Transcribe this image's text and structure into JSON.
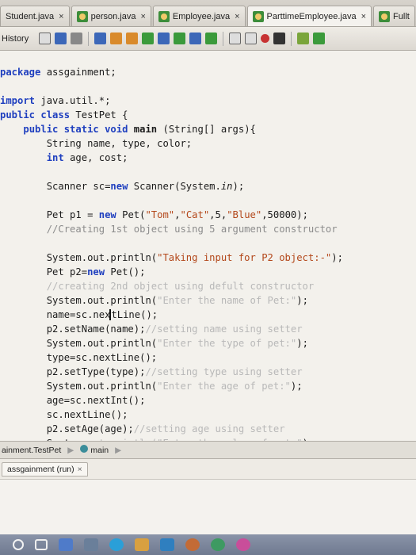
{
  "tabs": [
    {
      "label": "Student.java",
      "close": "×"
    },
    {
      "label": "person.java",
      "close": "×"
    },
    {
      "label": "Employee.java",
      "close": "×"
    },
    {
      "label": "ParttimeEmployee.java",
      "close": "×"
    },
    {
      "label": "Fullt",
      "close": ""
    }
  ],
  "toolbar": {
    "label": "History"
  },
  "code_lines": [
    "package assgainment;",
    "",
    "import java.util.*;",
    "public class TestPet {",
    "    public static void main (String[] args){",
    "        String name, type, color;",
    "        int age, cost;",
    "",
    "        Scanner sc=new Scanner(System.in);",
    "",
    "        Pet p1 = new Pet(\"Tom\",\"Cat\",5,\"Blue\",50000);",
    "        //Creating 1st object using 5 argument constructor",
    "",
    "        System.out.println(\"Taking input for P2 object:-\");",
    "        Pet p2=new Pet();",
    "        //creating 2nd object using defult constructor",
    "        System.out.println(\"Enter the name of Pet:\");",
    "        name=sc.nextLine();",
    "        p2.setName(name);//setting name using setter",
    "        System.out.println(\"Enter the type of pet:\");",
    "        type=sc.nextLine();",
    "        p2.setType(type);//setting type using setter",
    "        System.out.println(\"Enter the age of pet:\");",
    "        age=sc.nextInt();",
    "        sc.nextLine();",
    "        p2.setAge(age);//setting age using setter",
    "        System.out.println(\"Enter the color of pet:\");"
  ],
  "breadcrumb": {
    "class": "ainment.TestPet",
    "method": "main"
  },
  "output": {
    "tab_label": "assgainment (run)",
    "close": "×"
  }
}
